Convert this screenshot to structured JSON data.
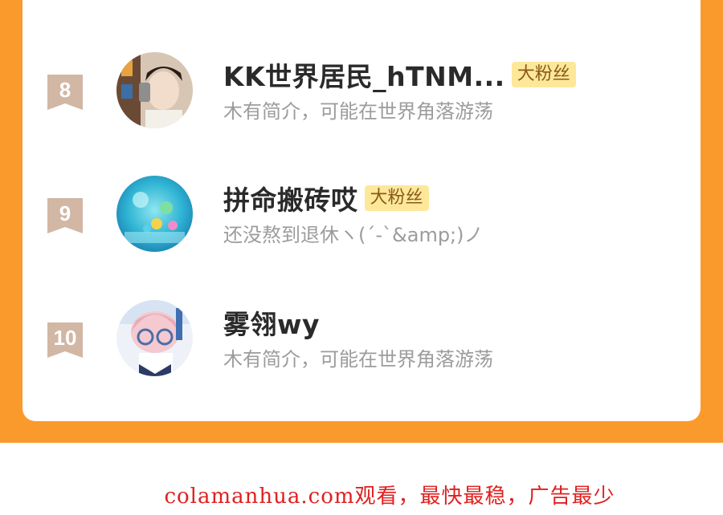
{
  "list": {
    "items": [
      {
        "rank": "8",
        "name": "KK世界居民_hTNM...",
        "badge": "大粉丝",
        "bio": "木有简介，可能在世界角落游荡",
        "avatar": "avatar-selfie"
      },
      {
        "rank": "9",
        "name": "拼命搬砖哎",
        "badge": "大粉丝",
        "bio": "还没熬到退休ヽ(´-`&amp;)ノ",
        "avatar": "avatar-aquarium"
      },
      {
        "rank": "10",
        "name": "雾翎wy",
        "badge": "",
        "bio": "木有简介，可能在世界角落游荡",
        "avatar": "avatar-anime-girl"
      }
    ]
  },
  "watermark": {
    "text": "colamanhua.com观看，最快最稳，广告最少"
  },
  "colors": {
    "frame": "#fb9a2c",
    "rank_badge": "#d1b7a4",
    "fan_badge_bg": "#fde89a",
    "fan_badge_text": "#8a5a18",
    "watermark": "#e02020"
  }
}
